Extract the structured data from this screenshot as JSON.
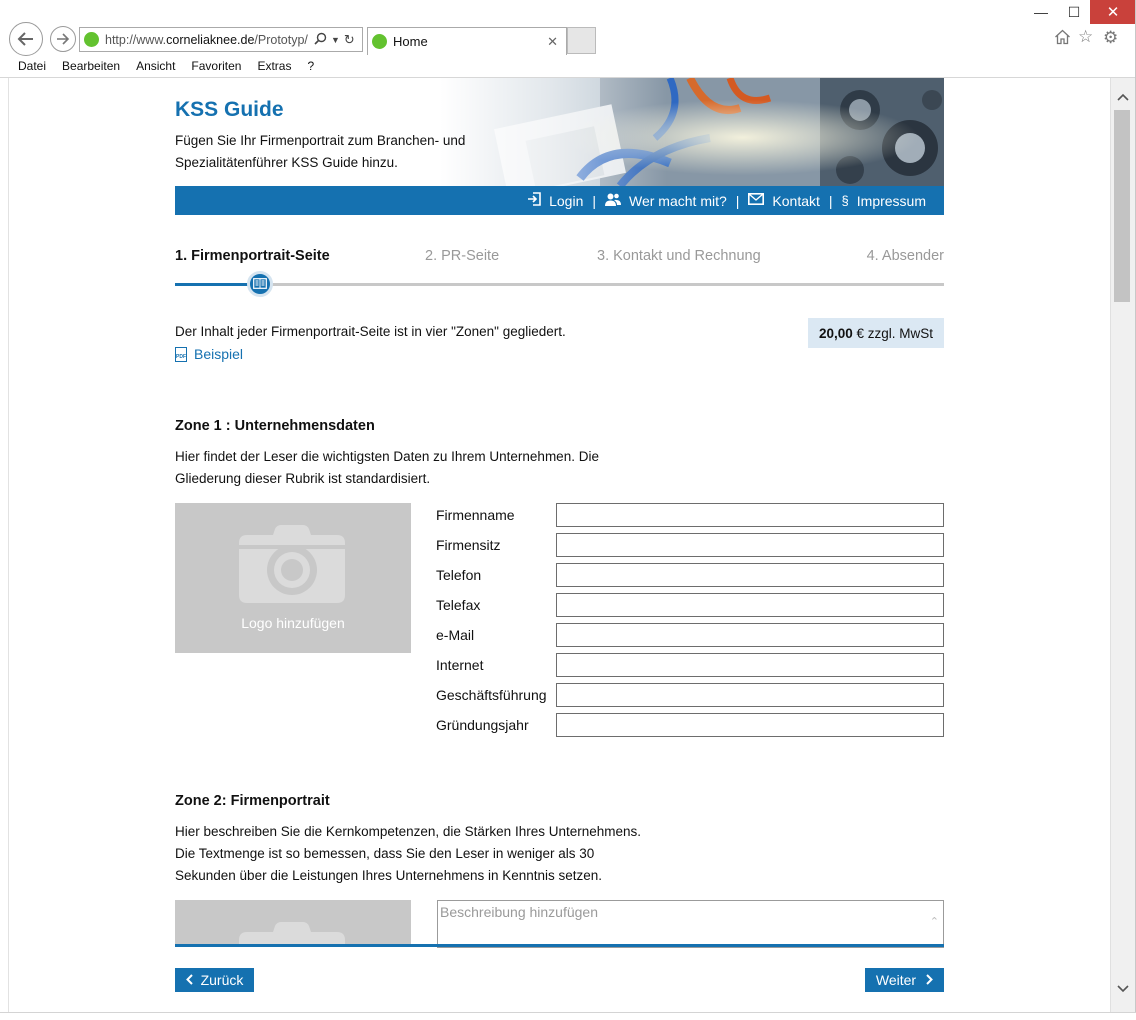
{
  "browser": {
    "url_prefix": "http://www.",
    "url_domain": "corneliaknee.de",
    "url_path": "/Prototyp/",
    "tab_title": "Home",
    "menu": [
      "Datei",
      "Bearbeiten",
      "Ansicht",
      "Favoriten",
      "Extras",
      "?"
    ]
  },
  "header": {
    "title": "KSS Guide",
    "subtitle": "Fügen Sie Ihr Firmenportrait zum Branchen- und Spezialitätenführer KSS Guide hinzu."
  },
  "nav": {
    "login": "Login",
    "participants": "Wer macht mit?",
    "contact": "Kontakt",
    "imprint": "Impressum",
    "separator": "|"
  },
  "steps": {
    "step1": "1. Firmenportrait-Seite",
    "step2": "2. PR-Seite",
    "step3": "3. Kontakt und Rechnung",
    "step4": "4. Absender",
    "current": 1,
    "total": 4
  },
  "intro": {
    "text": "Der Inhalt jeder Firmenportrait-Seite ist in vier \"Zonen\" gegliedert.",
    "example_link": "Beispiel",
    "price_amount": "20,00",
    "price_suffix": " € zzgl. MwSt"
  },
  "zone1": {
    "title": "Zone 1 : Unternehmensdaten",
    "desc_line1": "Hier findet der Leser die wichtigsten Daten zu Ihrem Unternehmen. Die",
    "desc_line2": "Gliederung dieser Rubrik ist standardisiert.",
    "logo_label": "Logo hinzufügen",
    "fields": {
      "company": "Firmenname",
      "seat": "Firmensitz",
      "phone": "Telefon",
      "fax": "Telefax",
      "email": "e-Mail",
      "web": "Internet",
      "management": "Geschäftsführung",
      "founded": "Gründungsjahr"
    }
  },
  "zone2": {
    "title": "Zone 2: Firmenportrait",
    "desc_line1": "Hier beschreiben Sie die Kernkompetenzen, die Stärken Ihres Unternehmens.",
    "desc_line2": "Die Textmenge ist so bemessen, dass Sie den Leser in weniger als 30",
    "desc_line3": "Sekunden über die Leistungen Ihres Unternehmens in Kenntnis setzen.",
    "placeholder": "Beschreibung hinzufügen"
  },
  "buttons": {
    "back": "Zurück",
    "next": "Weiter"
  },
  "colors": {
    "brand_blue": "#1571b0",
    "price_bg": "#dbe8f3",
    "placeholder_grey": "#c8c8c8"
  }
}
